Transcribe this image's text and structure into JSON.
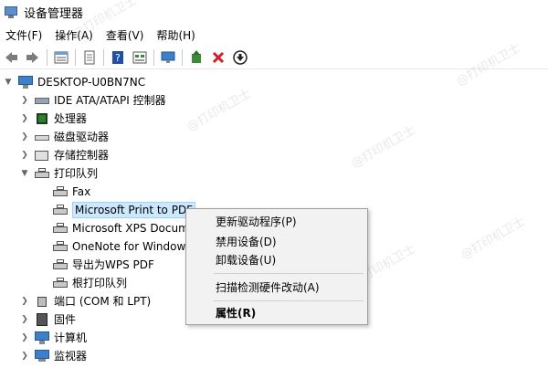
{
  "window": {
    "title": "设备管理器"
  },
  "menu": [
    "文件(F)",
    "操作(A)",
    "查看(V)",
    "帮助(H)"
  ],
  "toolbar": [
    "back-icon",
    "forward-icon",
    "properties-icon",
    "help-icon",
    "update-driver-icon",
    "scan-icon",
    "enable-icon",
    "uninstall-icon",
    "download-icon"
  ],
  "tree": {
    "root": "DESKTOP-U0BN7NC",
    "items": [
      {
        "label": "IDE ATA/ATAPI 控制器",
        "icon": "ide-controller-icon"
      },
      {
        "label": "处理器",
        "icon": "processor-icon"
      },
      {
        "label": "磁盘驱动器",
        "icon": "disk-drive-icon"
      },
      {
        "label": "存储控制器",
        "icon": "storage-controller-icon"
      },
      {
        "label": "打印队列",
        "icon": "print-queue-icon"
      }
    ],
    "print_children": [
      "Fax",
      "Microsoft Print to PDF",
      "Microsoft XPS Docum",
      "OneNote for Window",
      "导出为WPS PDF",
      "根打印队列"
    ],
    "after_items": [
      {
        "label": "端口 (COM 和 LPT)",
        "icon": "port-icon"
      },
      {
        "label": "固件",
        "icon": "firmware-icon"
      },
      {
        "label": "计算机",
        "icon": "computer-icon"
      },
      {
        "label": "监视器",
        "icon": "monitor-icon"
      }
    ]
  },
  "context_menu": {
    "update_driver": "更新驱动程序(P)",
    "disable": "禁用设备(D)",
    "uninstall": "卸载设备(U)",
    "scan": "扫描检测硬件改动(A)",
    "properties": "属性(R)"
  },
  "watermark": "@打印机卫士",
  "colors": {
    "selection": "#cce8ff",
    "selection_border": "#99d1ff",
    "menu_bg": "#f2f2f2"
  }
}
